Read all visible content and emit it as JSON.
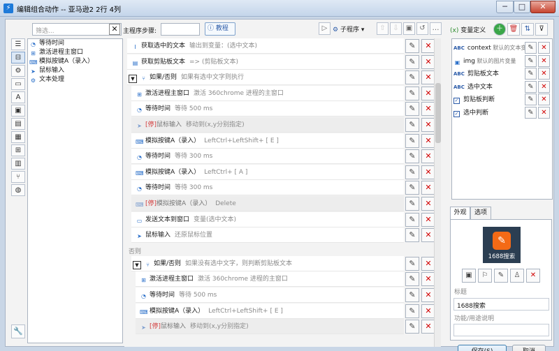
{
  "window": {
    "title": "编辑组合动作 -- 亚马逊2 2行 4列",
    "minimize": "─",
    "maximize": "□",
    "close": "✕"
  },
  "left_strip": {
    "icons": [
      "list-icon",
      "bookmark-icon",
      "gear-icon",
      "window-icon",
      "text-a-icon",
      "image-icon",
      "clipboard-icon",
      "document-icon",
      "windows-logo-icon",
      "calculator-icon",
      "branch-icon",
      "globe-icon"
    ],
    "glyphs": [
      "☰",
      "⊟",
      "⚙",
      "▭",
      "A",
      "▣",
      "▤",
      "▦",
      "⊞",
      "▥",
      "⑂",
      "◍"
    ],
    "wrench_glyph": "🔧"
  },
  "left_panel": {
    "filter_placeholder": "筛选...",
    "clear": "✕",
    "items": [
      {
        "icon": "clock-icon",
        "glyph": "◔",
        "color": "#2a6fc9",
        "label": "等待时间"
      },
      {
        "icon": "windows-logo-icon",
        "glyph": "⊞",
        "color": "#2a6fc9",
        "label": "激活进程主窗口"
      },
      {
        "icon": "keyboard-icon",
        "glyph": "⌨",
        "color": "#2a6fc9",
        "label": "模拟按键A（录入）"
      },
      {
        "icon": "mouse-cursor-icon",
        "glyph": "➤",
        "color": "#2a6fc9",
        "label": "鼠标输入"
      },
      {
        "icon": "gear-icon",
        "glyph": "⚙",
        "color": "#2a6fc9",
        "label": "文本处理"
      }
    ]
  },
  "toolbar": {
    "steps_label": "主程序步骤:",
    "tutorial": "教程",
    "subprocess": "子程序",
    "buttons": [
      "▷",
      "⇧",
      "⇩",
      "▣",
      "↺",
      "…"
    ]
  },
  "steps": [
    {
      "indent": 0,
      "icon": "cursor-icon",
      "glyph": "I",
      "title": "获取选中的文本",
      "desc": "输出到变量：(选中文本)",
      "disabled": false
    },
    {
      "indent": 0,
      "icon": "clipboard-icon",
      "glyph": "▤",
      "title": "获取剪贴板文本",
      "desc": "=> (剪贴板文本)",
      "disabled": false
    },
    {
      "indent": 0,
      "icon": "branch-icon",
      "glyph": "⑂",
      "title": "如果/否则",
      "desc": "如果有选中文字则执行",
      "collapse": "▼",
      "disabled": false
    },
    {
      "indent": 1,
      "icon": "windows-logo-icon",
      "glyph": "⊞",
      "title": "激活进程主窗口",
      "desc": "激活 360chrome 进程的主窗口",
      "disabled": false
    },
    {
      "indent": 1,
      "icon": "clock-icon",
      "glyph": "◔",
      "title": "等待时间",
      "desc": "等待 500 ms",
      "disabled": false
    },
    {
      "indent": 1,
      "icon": "mouse-cursor-icon",
      "glyph": "➤",
      "tag": "[停]",
      "title": "鼠标输入",
      "desc": "移动到(x,y分别指定)",
      "disabled": true
    },
    {
      "indent": 1,
      "icon": "keyboard-icon",
      "glyph": "⌨",
      "title": "模拟按键A（录入）",
      "desc": "LeftCtrl+LeftShift+ [ E ]",
      "disabled": false
    },
    {
      "indent": 1,
      "icon": "clock-icon",
      "glyph": "◔",
      "title": "等待时间",
      "desc": "等待 300 ms",
      "disabled": false
    },
    {
      "indent": 1,
      "icon": "keyboard-icon",
      "glyph": "⌨",
      "title": "模拟按键A（录入）",
      "desc": "LeftCtrl+ [ A ]",
      "disabled": false
    },
    {
      "indent": 1,
      "icon": "clock-icon",
      "glyph": "◔",
      "title": "等待时间",
      "desc": "等待 300 ms",
      "disabled": false
    },
    {
      "indent": 1,
      "icon": "keyboard-icon",
      "glyph": "⌨",
      "tag": "[停]",
      "title": "模拟按键A（录入）",
      "desc": "Delete",
      "disabled": true
    },
    {
      "indent": 1,
      "icon": "send-text-icon",
      "glyph": "▭",
      "title": "发送文本到窗口",
      "desc": "变量(选中文本)",
      "disabled": false
    },
    {
      "indent": 1,
      "icon": "mouse-cursor-icon",
      "glyph": "➤",
      "title": "鼠标输入",
      "desc": "还原鼠标位置",
      "disabled": false
    },
    {
      "else": true,
      "label": "否则"
    },
    {
      "indent": 1,
      "icon": "branch-icon",
      "glyph": "⑂",
      "title": "如果/否则",
      "desc": "如果没有选中文字，则判断剪贴板文本",
      "collapse": "▼",
      "disabled": false
    },
    {
      "indent": 2,
      "icon": "windows-logo-icon",
      "glyph": "⊞",
      "title": "激活进程主窗口",
      "desc": "激活 360chrome 进程的主窗口",
      "disabled": false
    },
    {
      "indent": 2,
      "icon": "clock-icon",
      "glyph": "◔",
      "title": "等待时间",
      "desc": "等待 500 ms",
      "disabled": false
    },
    {
      "indent": 2,
      "icon": "keyboard-icon",
      "glyph": "⌨",
      "title": "模拟按键A（录入）",
      "desc": "LeftCtrl+LeftShift+ [ E ]",
      "disabled": false
    },
    {
      "indent": 2,
      "icon": "mouse-cursor-icon",
      "glyph": "➤",
      "tag": "[停]",
      "title": "鼠标输入",
      "desc": "移动到(x,y分别指定)",
      "disabled": true
    }
  ],
  "row_buttons": {
    "edit": "✎",
    "delete": "✕"
  },
  "variables": {
    "header": "变量定义",
    "header_prefix": "(x)",
    "buttons": [
      "＋",
      "🗑",
      "⇅",
      "⊽"
    ],
    "items": [
      {
        "kind": "abc",
        "icon": "abc-type-icon",
        "name": "context",
        "desc": "默认的文本变"
      },
      {
        "kind": "img",
        "icon": "image-type-icon",
        "name": "img",
        "desc": "默认的图片变量"
      },
      {
        "kind": "abc",
        "icon": "abc-type-icon",
        "name": "剪贴板文本",
        "desc": ""
      },
      {
        "kind": "abc",
        "icon": "abc-type-icon",
        "name": "选中文本",
        "desc": ""
      },
      {
        "kind": "check",
        "icon": "checkbox-icon",
        "name": "剪贴板判断",
        "desc": ""
      },
      {
        "kind": "check",
        "icon": "checkbox-icon",
        "name": "选中判断",
        "desc": ""
      }
    ],
    "abc_label": "ABC"
  },
  "appearance": {
    "tabs": [
      "外观",
      "选项"
    ],
    "preview_label": "1688搜索",
    "preview_logo": "✎",
    "icon_buttons": [
      "▣",
      "⚐",
      "✎",
      "♙",
      "✕"
    ],
    "title_label": "标题",
    "title_value": "1688搜索",
    "desc_label": "功能/用途说明",
    "desc_value": ""
  },
  "footer": {
    "save": "保存(S)",
    "cancel": "取消"
  }
}
